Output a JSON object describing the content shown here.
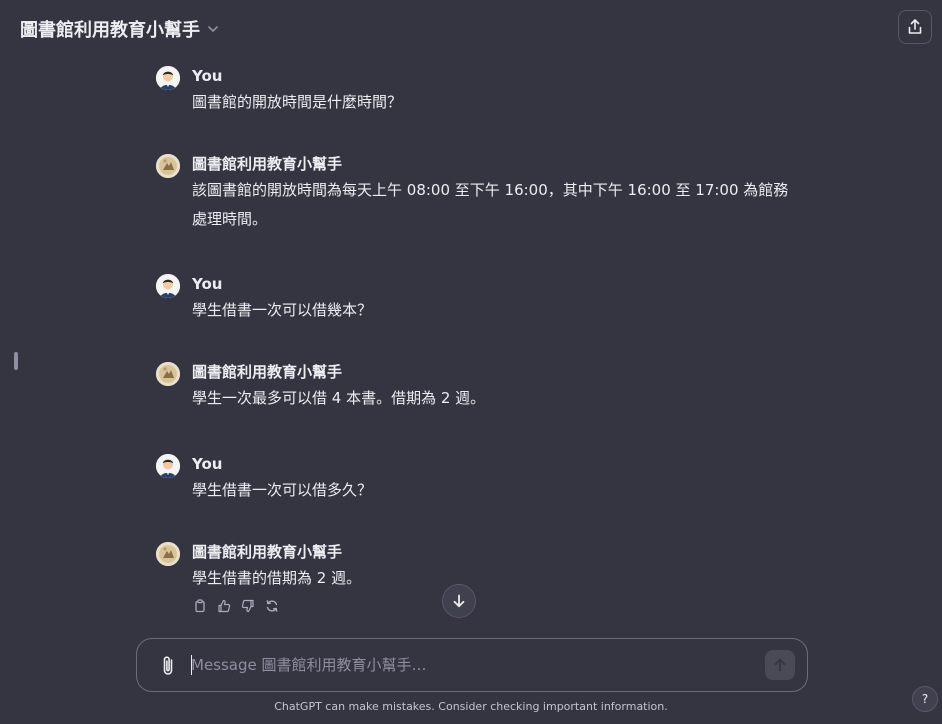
{
  "header": {
    "title": "圖書館利用教育小幫手",
    "chevron_icon": "chevron-down-icon",
    "share_icon": "share-upload-icon"
  },
  "messages": [
    {
      "role": "user",
      "name": "You",
      "text": "圖書館的開放時間是什麼時間？"
    },
    {
      "role": "assistant",
      "name": "圖書館利用教育小幫手",
      "text": "該圖書館的開放時間為每天上午 08:00 至下午 16:00，其中下午 16:00 至 17:00 為館務處理時間。"
    },
    {
      "role": "user",
      "name": "You",
      "text": "學生借書一次可以借幾本？"
    },
    {
      "role": "assistant",
      "name": "圖書館利用教育小幫手",
      "text": "學生一次最多可以借 4 本書。借期為 2 週。"
    },
    {
      "role": "user",
      "name": "You",
      "text": "學生借書一次可以借多久？"
    },
    {
      "role": "assistant",
      "name": "圖書館利用教育小幫手",
      "text": "學生借書的借期為 2 週。"
    }
  ],
  "message_actions": [
    "copy-icon",
    "thumbs-up-icon",
    "thumbs-down-icon",
    "regenerate-icon"
  ],
  "composer": {
    "placeholder": "Message 圖書館利用教育小幫手…",
    "value": "",
    "attach_icon": "paperclip-icon",
    "send_icon": "arrow-up-icon"
  },
  "disclaimer": "ChatGPT can make mistakes. Consider checking important information.",
  "help_label": "?",
  "colors": {
    "background": "#343541",
    "text": "#ececf1",
    "muted": "#8e8ea0",
    "border": "#565869"
  }
}
